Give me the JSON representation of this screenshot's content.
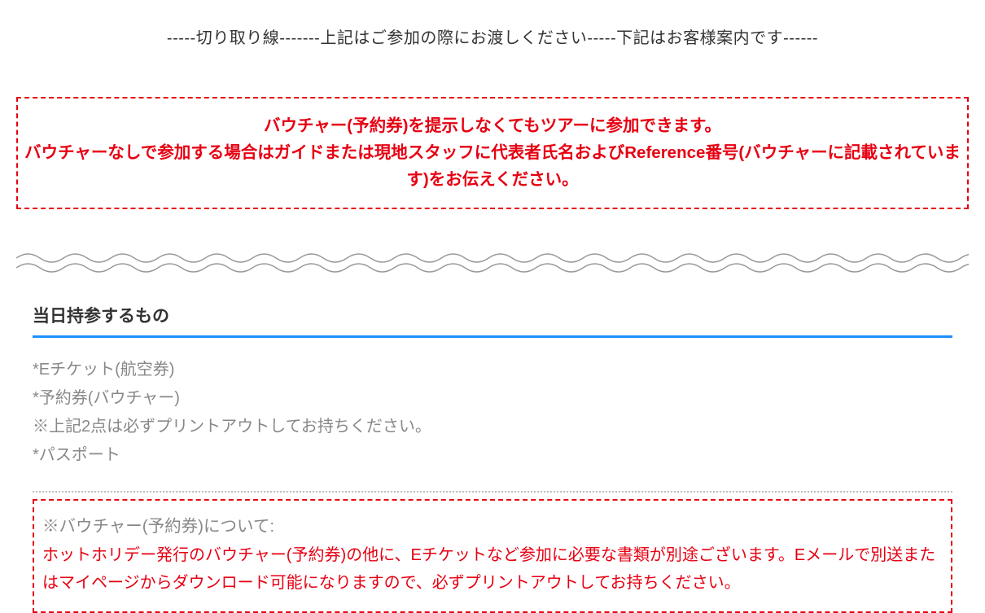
{
  "cutline": "-----切り取り線-------上記はご参加の際にお渡しください-----下記はお客様案内です------",
  "notice": {
    "line1": "バウチャー(予約券)を提示しなくてもツアーに参加できます。",
    "line2": "バウチャーなしで参加する場合はガイドまたは現地スタッフに代表者氏名およびReference番号(バウチャーに記載されています)をお伝えください。"
  },
  "section_heading": "当日持参するもの",
  "checklist": [
    "*Eチケット(航空券)",
    "*予約券(バウチャー)",
    "※上記2点は必ずプリントアウトしてお持ちください。",
    "*パスポート"
  ],
  "info_title": "※バウチャー(予約券)について:",
  "info_body": "ホットホリデー発行のバウチャー(予約券)の他に、Eチケットなど参加に必要な書類が別途ございます。Eメールで別送またはマイページからダウンロード可能になりますので、必ずプリントアウトしてお持ちください。"
}
